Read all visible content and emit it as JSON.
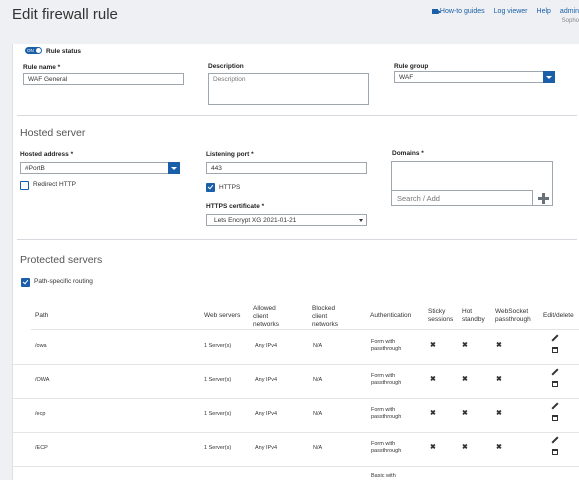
{
  "header": {
    "title": "Edit firewall rule",
    "links": [
      "How-to guides",
      "Log viewer",
      "Help",
      "admin"
    ],
    "org": "Sopho"
  },
  "rule": {
    "status_label": "Rule status",
    "toggle_label": "ON",
    "name_label": "Rule name *",
    "name_value": "WAF General",
    "description_label": "Description",
    "description_placeholder": "Description",
    "group_label": "Rule group",
    "group_value": "WAF"
  },
  "hosted": {
    "section_title": "Hosted server",
    "address_label": "Hosted address *",
    "address_value": "#PortB",
    "redirect_label": "Redirect HTTP",
    "port_label": "Listening port *",
    "port_value": "443",
    "https_label": "HTTPS",
    "cert_label": "HTTPS certificate *",
    "cert_value": "Lets Encrypt XG 2021-01-21",
    "domains_label": "Domains *",
    "domains_placeholder": "Search / Add"
  },
  "protected": {
    "section_title": "Protected servers",
    "path_routing_label": "Path-specific routing",
    "columns": {
      "path": "Path",
      "web_servers": "Web servers",
      "allowed": "Allowed client networks",
      "blocked": "Blocked client networks",
      "auth": "Authentication",
      "sticky": "Sticky sessions",
      "hot": "Hot standby",
      "websocket": "WebSocket passthrough",
      "edit": "Edit/delete"
    },
    "rows": [
      {
        "path": "/owa",
        "servers": "1 Server(s)",
        "allowed": "Any IPv4",
        "blocked": "N/A",
        "auth": "Form with passthrough",
        "sticky": "✖",
        "hot": "✖",
        "ws": "✖"
      },
      {
        "path": "/OWA",
        "servers": "1 Server(s)",
        "allowed": "Any IPv4",
        "blocked": "N/A",
        "auth": "Form with passthrough",
        "sticky": "✖",
        "hot": "✖",
        "ws": "✖"
      },
      {
        "path": "/ecp",
        "servers": "1 Server(s)",
        "allowed": "Any IPv4",
        "blocked": "N/A",
        "auth": "Form with passthrough",
        "sticky": "✖",
        "hot": "✖",
        "ws": "✖"
      },
      {
        "path": "/ECP",
        "servers": "1 Server(s)",
        "allowed": "Any IPv4",
        "blocked": "N/A",
        "auth": "Form with passthrough",
        "sticky": "✖",
        "hot": "✖",
        "ws": "✖"
      },
      {
        "path": "",
        "servers": "",
        "allowed": "",
        "blocked": "",
        "auth": "Basic with",
        "sticky": "",
        "hot": "",
        "ws": ""
      }
    ]
  },
  "colors": {
    "accent": "#1b5fa8",
    "background": "#eef0f3",
    "panel": "#ffffff"
  }
}
